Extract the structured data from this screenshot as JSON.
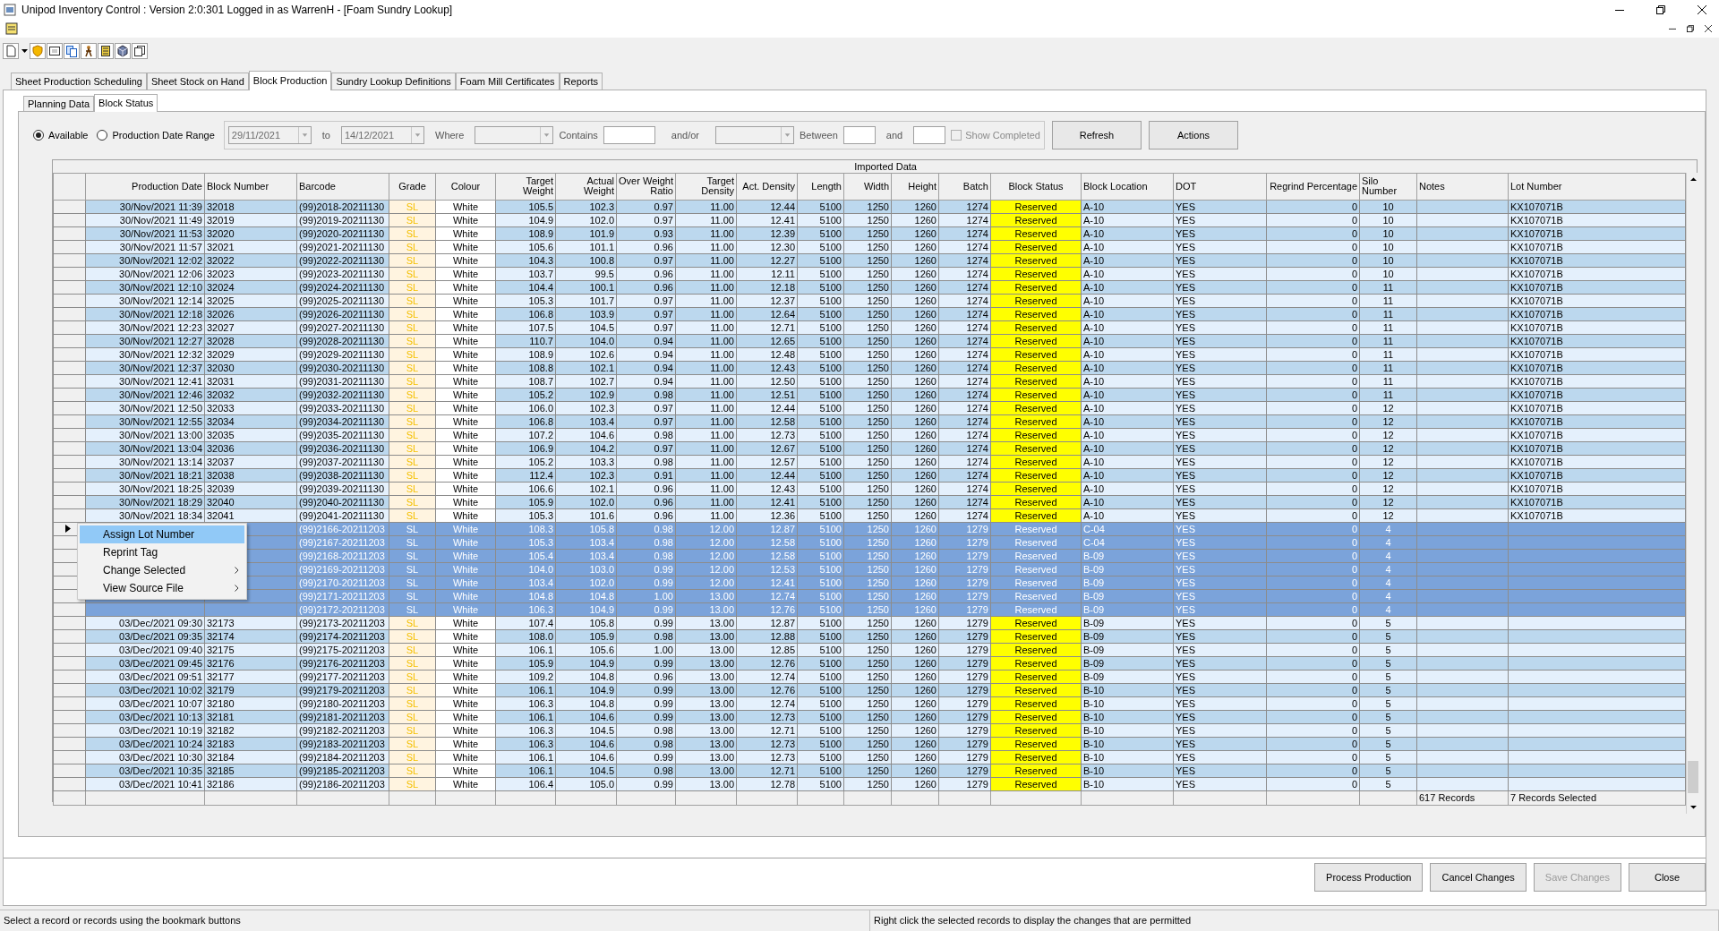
{
  "window": {
    "title": "Unipod Inventory Control : Version 2:0:301 Logged in as WarrenH - [Foam Sundry Lookup]"
  },
  "tabs": [
    {
      "label": "Sheet Production Scheduling",
      "selected": false
    },
    {
      "label": "Sheet Stock on Hand",
      "selected": false
    },
    {
      "label": "Block Production",
      "selected": true
    },
    {
      "label": "Sundry Lookup Definitions",
      "selected": false
    },
    {
      "label": "Foam Mill Certificates",
      "selected": false
    },
    {
      "label": "Reports",
      "selected": false
    }
  ],
  "sub_tabs": [
    {
      "label": "Planning Data",
      "selected": false
    },
    {
      "label": "Block Status",
      "selected": true
    }
  ],
  "filter": {
    "radios": [
      {
        "label": "Available",
        "selected": true
      },
      {
        "label": "Production Date Range",
        "selected": false
      }
    ],
    "from_date": "29/11/2021",
    "to_label": "to",
    "to_date": "14/12/2021",
    "where_label": "Where",
    "contains_label": "Contains",
    "andor_label": "and/or",
    "between_label": "Between",
    "and_label": "and",
    "show_completed": {
      "label": "Show Completed",
      "checked": false,
      "disabled": true
    },
    "buttons": [
      "Refresh",
      "Actions"
    ]
  },
  "table": {
    "group_header": "Imported Data",
    "columns": [
      "Production Date",
      "Block Number",
      "Barcode",
      "Grade",
      "Colour",
      "Target Weight",
      "Actual Weight",
      "Over Weight Ratio",
      "Target Density",
      "Act. Density",
      "Length",
      "Width",
      "Height",
      "Batch",
      "Block Status",
      "Block Location",
      "DOT",
      "Regrind Percentage",
      "Silo Number",
      "Notes",
      "Lot Number"
    ],
    "rows": [
      {
        "selected": false,
        "current": false,
        "cells": [
          "30/Nov/2021 11:39",
          "32018",
          "(99)2018-20211130",
          "SL",
          "White",
          "105.5",
          "102.3",
          "0.97",
          "11.00",
          "12.44",
          "5100",
          "1250",
          "1260",
          "1274",
          "Reserved",
          "A-10",
          "YES",
          "0",
          "10",
          null,
          "KX107071B"
        ]
      },
      {
        "selected": false,
        "current": false,
        "cells": [
          "30/Nov/2021 11:49",
          "32019",
          "(99)2019-20211130",
          "SL",
          "White",
          "104.9",
          "102.0",
          "0.97",
          "11.00",
          "12.41",
          "5100",
          "1250",
          "1260",
          "1274",
          "Reserved",
          "A-10",
          "YES",
          "0",
          "10",
          null,
          "KX107071B"
        ]
      },
      {
        "selected": false,
        "current": false,
        "cells": [
          "30/Nov/2021 11:53",
          "32020",
          "(99)2020-20211130",
          "SL",
          "White",
          "108.9",
          "101.9",
          "0.93",
          "11.00",
          "12.39",
          "5100",
          "1250",
          "1260",
          "1274",
          "Reserved",
          "A-10",
          "YES",
          "0",
          "10",
          null,
          "KX107071B"
        ]
      },
      {
        "selected": false,
        "current": false,
        "cells": [
          "30/Nov/2021 11:57",
          "32021",
          "(99)2021-20211130",
          "SL",
          "White",
          "105.6",
          "101.1",
          "0.96",
          "11.00",
          "12.30",
          "5100",
          "1250",
          "1260",
          "1274",
          "Reserved",
          "A-10",
          "YES",
          "0",
          "10",
          null,
          "KX107071B"
        ]
      },
      {
        "selected": false,
        "current": false,
        "cells": [
          "30/Nov/2021 12:02",
          "32022",
          "(99)2022-20211130",
          "SL",
          "White",
          "104.3",
          "100.8",
          "0.97",
          "11.00",
          "12.27",
          "5100",
          "1250",
          "1260",
          "1274",
          "Reserved",
          "A-10",
          "YES",
          "0",
          "10",
          null,
          "KX107071B"
        ]
      },
      {
        "selected": false,
        "current": false,
        "cells": [
          "30/Nov/2021 12:06",
          "32023",
          "(99)2023-20211130",
          "SL",
          "White",
          "103.7",
          "99.5",
          "0.96",
          "11.00",
          "12.11",
          "5100",
          "1250",
          "1260",
          "1274",
          "Reserved",
          "A-10",
          "YES",
          "0",
          "10",
          null,
          "KX107071B"
        ]
      },
      {
        "selected": false,
        "current": false,
        "cells": [
          "30/Nov/2021 12:10",
          "32024",
          "(99)2024-20211130",
          "SL",
          "White",
          "104.4",
          "100.1",
          "0.96",
          "11.00",
          "12.18",
          "5100",
          "1250",
          "1260",
          "1274",
          "Reserved",
          "A-10",
          "YES",
          "0",
          "11",
          null,
          "KX107071B"
        ]
      },
      {
        "selected": false,
        "current": false,
        "cells": [
          "30/Nov/2021 12:14",
          "32025",
          "(99)2025-20211130",
          "SL",
          "White",
          "105.3",
          "101.7",
          "0.97",
          "11.00",
          "12.37",
          "5100",
          "1250",
          "1260",
          "1274",
          "Reserved",
          "A-10",
          "YES",
          "0",
          "11",
          null,
          "KX107071B"
        ]
      },
      {
        "selected": false,
        "current": false,
        "cells": [
          "30/Nov/2021 12:18",
          "32026",
          "(99)2026-20211130",
          "SL",
          "White",
          "106.8",
          "103.9",
          "0.97",
          "11.00",
          "12.64",
          "5100",
          "1250",
          "1260",
          "1274",
          "Reserved",
          "A-10",
          "YES",
          "0",
          "11",
          null,
          "KX107071B"
        ]
      },
      {
        "selected": false,
        "current": false,
        "cells": [
          "30/Nov/2021 12:23",
          "32027",
          "(99)2027-20211130",
          "SL",
          "White",
          "107.5",
          "104.5",
          "0.97",
          "11.00",
          "12.71",
          "5100",
          "1250",
          "1260",
          "1274",
          "Reserved",
          "A-10",
          "YES",
          "0",
          "11",
          null,
          "KX107071B"
        ]
      },
      {
        "selected": false,
        "current": false,
        "cells": [
          "30/Nov/2021 12:27",
          "32028",
          "(99)2028-20211130",
          "SL",
          "White",
          "110.7",
          "104.0",
          "0.94",
          "11.00",
          "12.65",
          "5100",
          "1250",
          "1260",
          "1274",
          "Reserved",
          "A-10",
          "YES",
          "0",
          "11",
          null,
          "KX107071B"
        ]
      },
      {
        "selected": false,
        "current": false,
        "cells": [
          "30/Nov/2021 12:32",
          "32029",
          "(99)2029-20211130",
          "SL",
          "White",
          "108.9",
          "102.6",
          "0.94",
          "11.00",
          "12.48",
          "5100",
          "1250",
          "1260",
          "1274",
          "Reserved",
          "A-10",
          "YES",
          "0",
          "11",
          null,
          "KX107071B"
        ]
      },
      {
        "selected": false,
        "current": false,
        "cells": [
          "30/Nov/2021 12:37",
          "32030",
          "(99)2030-20211130",
          "SL",
          "White",
          "108.8",
          "102.1",
          "0.94",
          "11.00",
          "12.43",
          "5100",
          "1250",
          "1260",
          "1274",
          "Reserved",
          "A-10",
          "YES",
          "0",
          "11",
          null,
          "KX107071B"
        ]
      },
      {
        "selected": false,
        "current": false,
        "cells": [
          "30/Nov/2021 12:41",
          "32031",
          "(99)2031-20211130",
          "SL",
          "White",
          "108.7",
          "102.7",
          "0.94",
          "11.00",
          "12.50",
          "5100",
          "1250",
          "1260",
          "1274",
          "Reserved",
          "A-10",
          "YES",
          "0",
          "11",
          null,
          "KX107071B"
        ]
      },
      {
        "selected": false,
        "current": false,
        "cells": [
          "30/Nov/2021 12:46",
          "32032",
          "(99)2032-20211130",
          "SL",
          "White",
          "105.2",
          "102.9",
          "0.98",
          "11.00",
          "12.51",
          "5100",
          "1250",
          "1260",
          "1274",
          "Reserved",
          "A-10",
          "YES",
          "0",
          "11",
          null,
          "KX107071B"
        ]
      },
      {
        "selected": false,
        "current": false,
        "cells": [
          "30/Nov/2021 12:50",
          "32033",
          "(99)2033-20211130",
          "SL",
          "White",
          "106.0",
          "102.3",
          "0.97",
          "11.00",
          "12.44",
          "5100",
          "1250",
          "1260",
          "1274",
          "Reserved",
          "A-10",
          "YES",
          "0",
          "12",
          null,
          "KX107071B"
        ]
      },
      {
        "selected": false,
        "current": false,
        "cells": [
          "30/Nov/2021 12:55",
          "32034",
          "(99)2034-20211130",
          "SL",
          "White",
          "106.8",
          "103.4",
          "0.97",
          "11.00",
          "12.58",
          "5100",
          "1250",
          "1260",
          "1274",
          "Reserved",
          "A-10",
          "YES",
          "0",
          "12",
          null,
          "KX107071B"
        ]
      },
      {
        "selected": false,
        "current": false,
        "cells": [
          "30/Nov/2021 13:00",
          "32035",
          "(99)2035-20211130",
          "SL",
          "White",
          "107.2",
          "104.6",
          "0.98",
          "11.00",
          "12.73",
          "5100",
          "1250",
          "1260",
          "1274",
          "Reserved",
          "A-10",
          "YES",
          "0",
          "12",
          null,
          "KX107071B"
        ]
      },
      {
        "selected": false,
        "current": false,
        "cells": [
          "30/Nov/2021 13:04",
          "32036",
          "(99)2036-20211130",
          "SL",
          "White",
          "106.9",
          "104.2",
          "0.97",
          "11.00",
          "12.67",
          "5100",
          "1250",
          "1260",
          "1274",
          "Reserved",
          "A-10",
          "YES",
          "0",
          "12",
          null,
          "KX107071B"
        ]
      },
      {
        "selected": false,
        "current": false,
        "cells": [
          "30/Nov/2021 13:14",
          "32037",
          "(99)2037-20211130",
          "SL",
          "White",
          "105.2",
          "103.3",
          "0.98",
          "11.00",
          "12.57",
          "5100",
          "1250",
          "1260",
          "1274",
          "Reserved",
          "A-10",
          "YES",
          "0",
          "12",
          null,
          "KX107071B"
        ]
      },
      {
        "selected": false,
        "current": false,
        "cells": [
          "30/Nov/2021 18:21",
          "32038",
          "(99)2038-20211130",
          "SL",
          "White",
          "112.4",
          "102.3",
          "0.91",
          "11.00",
          "12.44",
          "5100",
          "1250",
          "1260",
          "1274",
          "Reserved",
          "A-10",
          "YES",
          "0",
          "12",
          null,
          "KX107071B"
        ]
      },
      {
        "selected": false,
        "current": false,
        "cells": [
          "30/Nov/2021 18:25",
          "32039",
          "(99)2039-20211130",
          "SL",
          "White",
          "106.6",
          "102.1",
          "0.96",
          "11.00",
          "12.43",
          "5100",
          "1250",
          "1260",
          "1274",
          "Reserved",
          "A-10",
          "YES",
          "0",
          "12",
          null,
          "KX107071B"
        ]
      },
      {
        "selected": false,
        "current": false,
        "cells": [
          "30/Nov/2021 18:29",
          "32040",
          "(99)2040-20211130",
          "SL",
          "White",
          "105.9",
          "102.0",
          "0.96",
          "11.00",
          "12.41",
          "5100",
          "1250",
          "1260",
          "1274",
          "Reserved",
          "A-10",
          "YES",
          "0",
          "12",
          null,
          "KX107071B"
        ]
      },
      {
        "selected": false,
        "current": false,
        "cells": [
          "30/Nov/2021 18:34",
          "32041",
          "(99)2041-20211130",
          "SL",
          "White",
          "105.3",
          "101.6",
          "0.96",
          "11.00",
          "12.36",
          "5100",
          "1250",
          "1260",
          "1274",
          "Reserved",
          "A-10",
          "YES",
          "0",
          "12",
          null,
          "KX107071B"
        ]
      },
      {
        "selected": true,
        "current": true,
        "cells": [
          null,
          null,
          "(99)2166-20211203",
          "SL",
          "White",
          "108.3",
          "105.8",
          "0.98",
          "12.00",
          "12.87",
          "5100",
          "1250",
          "1260",
          "1279",
          "Reserved",
          "C-04",
          "YES",
          "0",
          "4",
          null,
          null
        ]
      },
      {
        "selected": true,
        "current": false,
        "cells": [
          null,
          null,
          "(99)2167-20211203",
          "SL",
          "White",
          "105.3",
          "103.4",
          "0.98",
          "12.00",
          "12.58",
          "5100",
          "1250",
          "1260",
          "1279",
          "Reserved",
          "C-04",
          "YES",
          "0",
          "4",
          null,
          null
        ]
      },
      {
        "selected": true,
        "current": false,
        "cells": [
          null,
          null,
          "(99)2168-20211203",
          "SL",
          "White",
          "105.4",
          "103.4",
          "0.98",
          "12.00",
          "12.58",
          "5100",
          "1250",
          "1260",
          "1279",
          "Reserved",
          "B-09",
          "YES",
          "0",
          "4",
          null,
          null
        ]
      },
      {
        "selected": true,
        "current": false,
        "cells": [
          null,
          null,
          "(99)2169-20211203",
          "SL",
          "White",
          "104.0",
          "103.0",
          "0.99",
          "12.00",
          "12.53",
          "5100",
          "1250",
          "1260",
          "1279",
          "Reserved",
          "B-09",
          "YES",
          "0",
          "4",
          null,
          null
        ]
      },
      {
        "selected": true,
        "current": false,
        "cells": [
          null,
          null,
          "(99)2170-20211203",
          "SL",
          "White",
          "103.4",
          "102.0",
          "0.99",
          "12.00",
          "12.41",
          "5100",
          "1250",
          "1260",
          "1279",
          "Reserved",
          "B-09",
          "YES",
          "0",
          "4",
          null,
          null
        ]
      },
      {
        "selected": true,
        "current": false,
        "cells": [
          null,
          null,
          "(99)2171-20211203",
          "SL",
          "White",
          "104.8",
          "104.8",
          "1.00",
          "13.00",
          "12.74",
          "5100",
          "1250",
          "1260",
          "1279",
          "Reserved",
          "B-09",
          "YES",
          "0",
          "4",
          null,
          null
        ]
      },
      {
        "selected": true,
        "current": false,
        "cells": [
          null,
          null,
          "(99)2172-20211203",
          "SL",
          "White",
          "106.3",
          "104.9",
          "0.99",
          "13.00",
          "12.76",
          "5100",
          "1250",
          "1260",
          "1279",
          "Reserved",
          "B-09",
          "YES",
          "0",
          "4",
          null,
          null
        ]
      },
      {
        "selected": false,
        "current": false,
        "cells": [
          "03/Dec/2021 09:30",
          "32173",
          "(99)2173-20211203",
          "SL",
          "White",
          "107.4",
          "105.8",
          "0.99",
          "13.00",
          "12.87",
          "5100",
          "1250",
          "1260",
          "1279",
          "Reserved",
          "B-09",
          "YES",
          "0",
          "5",
          null,
          null
        ]
      },
      {
        "selected": false,
        "current": false,
        "cells": [
          "03/Dec/2021 09:35",
          "32174",
          "(99)2174-20211203",
          "SL",
          "White",
          "108.0",
          "105.9",
          "0.98",
          "13.00",
          "12.88",
          "5100",
          "1250",
          "1260",
          "1279",
          "Reserved",
          "B-09",
          "YES",
          "0",
          "5",
          null,
          null
        ]
      },
      {
        "selected": false,
        "current": false,
        "cells": [
          "03/Dec/2021 09:40",
          "32175",
          "(99)2175-20211203",
          "SL",
          "White",
          "106.1",
          "105.6",
          "1.00",
          "13.00",
          "12.85",
          "5100",
          "1250",
          "1260",
          "1279",
          "Reserved",
          "B-09",
          "YES",
          "0",
          "5",
          null,
          null
        ]
      },
      {
        "selected": false,
        "current": false,
        "cells": [
          "03/Dec/2021 09:45",
          "32176",
          "(99)2176-20211203",
          "SL",
          "White",
          "105.9",
          "104.9",
          "0.99",
          "13.00",
          "12.76",
          "5100",
          "1250",
          "1260",
          "1279",
          "Reserved",
          "B-09",
          "YES",
          "0",
          "5",
          null,
          null
        ]
      },
      {
        "selected": false,
        "current": false,
        "cells": [
          "03/Dec/2021 09:51",
          "32177",
          "(99)2177-20211203",
          "SL",
          "White",
          "109.2",
          "104.8",
          "0.96",
          "13.00",
          "12.74",
          "5100",
          "1250",
          "1260",
          "1279",
          "Reserved",
          "B-09",
          "YES",
          "0",
          "5",
          null,
          null
        ]
      },
      {
        "selected": false,
        "current": false,
        "cells": [
          "03/Dec/2021 10:02",
          "32179",
          "(99)2179-20211203",
          "SL",
          "White",
          "106.1",
          "104.9",
          "0.99",
          "13.00",
          "12.76",
          "5100",
          "1250",
          "1260",
          "1279",
          "Reserved",
          "B-10",
          "YES",
          "0",
          "5",
          null,
          null
        ]
      },
      {
        "selected": false,
        "current": false,
        "cells": [
          "03/Dec/2021 10:07",
          "32180",
          "(99)2180-20211203",
          "SL",
          "White",
          "106.3",
          "104.8",
          "0.99",
          "13.00",
          "12.74",
          "5100",
          "1250",
          "1260",
          "1279",
          "Reserved",
          "B-10",
          "YES",
          "0",
          "5",
          null,
          null
        ]
      },
      {
        "selected": false,
        "current": false,
        "cells": [
          "03/Dec/2021 10:13",
          "32181",
          "(99)2181-20211203",
          "SL",
          "White",
          "106.1",
          "104.6",
          "0.99",
          "13.00",
          "12.73",
          "5100",
          "1250",
          "1260",
          "1279",
          "Reserved",
          "B-10",
          "YES",
          "0",
          "5",
          null,
          null
        ]
      },
      {
        "selected": false,
        "current": false,
        "cells": [
          "03/Dec/2021 10:19",
          "32182",
          "(99)2182-20211203",
          "SL",
          "White",
          "106.3",
          "104.5",
          "0.98",
          "13.00",
          "12.71",
          "5100",
          "1250",
          "1260",
          "1279",
          "Reserved",
          "B-10",
          "YES",
          "0",
          "5",
          null,
          null
        ]
      },
      {
        "selected": false,
        "current": false,
        "cells": [
          "03/Dec/2021 10:24",
          "32183",
          "(99)2183-20211203",
          "SL",
          "White",
          "106.3",
          "104.6",
          "0.98",
          "13.00",
          "12.73",
          "5100",
          "1250",
          "1260",
          "1279",
          "Reserved",
          "B-10",
          "YES",
          "0",
          "5",
          null,
          null
        ]
      },
      {
        "selected": false,
        "current": false,
        "cells": [
          "03/Dec/2021 10:30",
          "32184",
          "(99)2184-20211203",
          "SL",
          "White",
          "106.1",
          "104.6",
          "0.99",
          "13.00",
          "12.73",
          "5100",
          "1250",
          "1260",
          "1279",
          "Reserved",
          "B-10",
          "YES",
          "0",
          "5",
          null,
          null
        ]
      },
      {
        "selected": false,
        "current": false,
        "cells": [
          "03/Dec/2021 10:35",
          "32185",
          "(99)2185-20211203",
          "SL",
          "White",
          "106.1",
          "104.5",
          "0.98",
          "13.00",
          "12.71",
          "5100",
          "1250",
          "1260",
          "1279",
          "Reserved",
          "B-10",
          "YES",
          "0",
          "5",
          null,
          null
        ]
      },
      {
        "selected": false,
        "current": false,
        "cells": [
          "03/Dec/2021 10:41",
          "32186",
          "(99)2186-20211203",
          "SL",
          "White",
          "106.4",
          "105.0",
          "0.99",
          "13.00",
          "12.78",
          "5100",
          "1250",
          "1260",
          "1279",
          "Reserved",
          "B-10",
          "YES",
          "0",
          "5",
          null,
          null
        ]
      }
    ],
    "footer": {
      "record_count": "617 Records",
      "selected_count": "7 Records Selected"
    }
  },
  "context_menu": [
    {
      "label": "Assign Lot Number",
      "selected": true,
      "submenu": false
    },
    {
      "label": "Reprint Tag",
      "selected": false,
      "submenu": false
    },
    {
      "label": "Change Selected",
      "selected": false,
      "submenu": true
    },
    {
      "label": "View Source File",
      "selected": false,
      "submenu": true
    }
  ],
  "buttons": [
    {
      "label": "Process Production",
      "disabled": false
    },
    {
      "label": "Cancel Changes",
      "disabled": false
    },
    {
      "label": "Save Changes",
      "disabled": true
    },
    {
      "label": "Close",
      "disabled": false
    }
  ],
  "status_bar": [
    "Select a record or records using the bookmark buttons",
    "Right click the selected records to display the changes that are permitted"
  ]
}
